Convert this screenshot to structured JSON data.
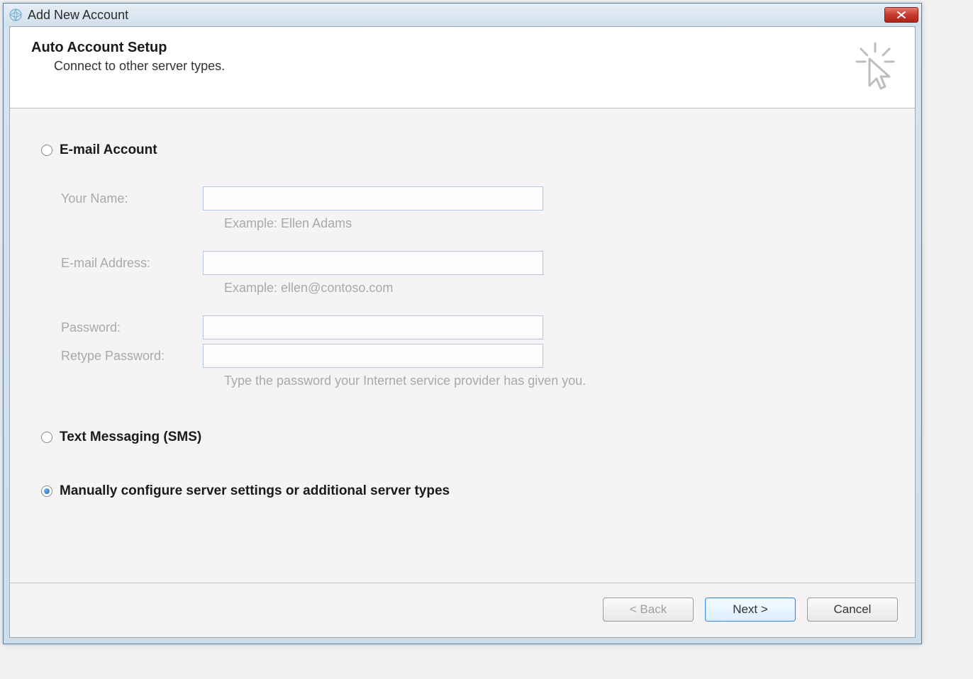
{
  "window": {
    "title": "Add New Account"
  },
  "header": {
    "title": "Auto Account Setup",
    "subtitle": "Connect to other server types."
  },
  "options": {
    "email_label": "E-mail Account",
    "sms_label": "Text Messaging (SMS)",
    "manual_label": "Manually configure server settings or additional server types",
    "selected": "manual"
  },
  "form": {
    "your_name_label": "Your Name:",
    "your_name_value": "",
    "your_name_hint": "Example: Ellen Adams",
    "email_label": "E-mail Address:",
    "email_value": "",
    "email_hint": "Example: ellen@contoso.com",
    "password_label": "Password:",
    "password_value": "",
    "retype_label": "Retype Password:",
    "retype_value": "",
    "password_hint": "Type the password your Internet service provider has given you."
  },
  "buttons": {
    "back": "< Back",
    "next": "Next >",
    "cancel": "Cancel"
  }
}
